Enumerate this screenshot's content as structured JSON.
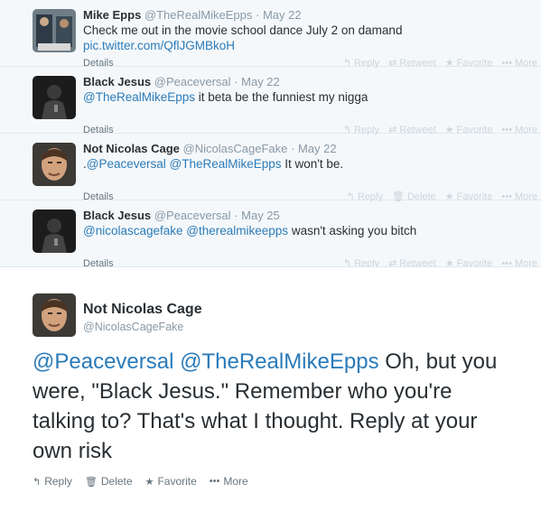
{
  "replies": [
    {
      "name": "Mike Epps",
      "handle": "@TheRealMikeEpps",
      "date": "May 22",
      "text_plain": "Check me out in the movie school dance July 2 on damand",
      "link": "pic.twitter.com/QflJGMBkoH",
      "details": "Details",
      "actions": [
        "Reply",
        "Retweet",
        "Favorite",
        "More"
      ]
    },
    {
      "name": "Black Jesus",
      "handle": "@Peaceversal",
      "date": "May 22",
      "mention": "@TheRealMikeEpps",
      "text_plain": " it beta be the funniest my nigga",
      "details": "Details",
      "actions": [
        "Reply",
        "Retweet",
        "Favorite",
        "More"
      ]
    },
    {
      "name": "Not Nicolas Cage",
      "handle": "@NicolasCageFake",
      "date": "May 22",
      "prefix": ".",
      "mention1": "@Peaceversal",
      "mention2": "@TheRealMikeEpps",
      "text_plain": " It won't be.",
      "details": "Details",
      "actions": [
        "Reply",
        "Delete",
        "Favorite",
        "More"
      ]
    },
    {
      "name": "Black Jesus",
      "handle": "@Peaceversal",
      "date": "May 25",
      "mention1": "@nicolascagefake",
      "mention2": "@therealmikeepps",
      "text_plain": " wasn't asking  you bitch",
      "details": "Details",
      "actions": [
        "Reply",
        "Retweet",
        "Favorite",
        "More"
      ]
    }
  ],
  "main": {
    "name": "Not Nicolas Cage",
    "handle": "@NicolasCageFake",
    "mention1": "@Peaceversal",
    "mention2": "@TheRealMikeEpps",
    "text_plain": " Oh, but you were, \"Black Jesus.\" Remember who you're talking to? That's what I thought. Reply at your own risk",
    "actions": [
      "Reply",
      "Delete",
      "Favorite",
      "More"
    ]
  },
  "colors": {
    "link": "#2b7bb9",
    "muted": "#8899a6",
    "bg_thread": "#f5f8fa"
  },
  "icons": [
    "reply-icon",
    "retweet-icon",
    "delete-icon",
    "favorite-icon",
    "more-icon"
  ]
}
